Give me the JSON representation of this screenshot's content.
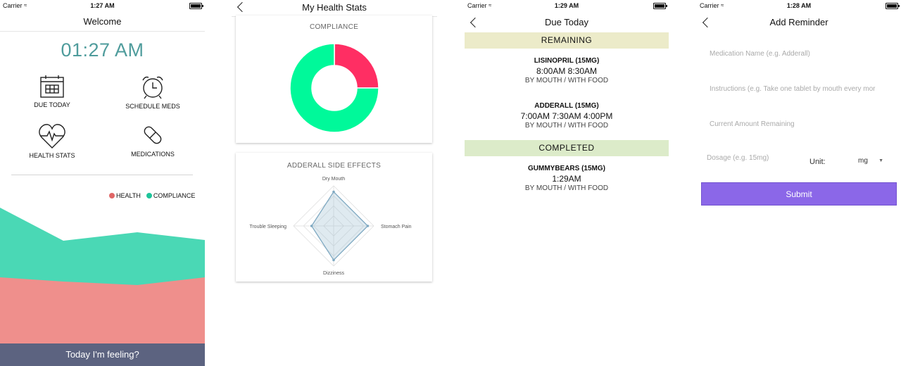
{
  "status": {
    "carrier": "Carrier"
  },
  "welcome": {
    "time": "1:27 AM",
    "title": "Welcome",
    "clock": "01:27 AM",
    "menu": [
      {
        "label": "DUE TODAY",
        "icon": "calendar-icon"
      },
      {
        "label": "SCHEDULE MEDS",
        "icon": "alarm-clock-icon"
      },
      {
        "label": "HEALTH STATS",
        "icon": "heart-pulse-icon"
      },
      {
        "label": "MEDICATIONS",
        "icon": "pill-icon"
      }
    ],
    "legend": [
      {
        "label": "HEALTH",
        "color": "#e06666"
      },
      {
        "label": "COMPLIANCE",
        "color": "#1ec49a"
      }
    ],
    "footer": "Today I'm feeling?"
  },
  "stats": {
    "title": "My Health Stats",
    "compliance_title": "COMPLIANCE",
    "side_effects_title": "ADDERALL SIDE EFFECTS",
    "chart_data": [
      {
        "type": "pie",
        "title": "COMPLIANCE",
        "values": [
          25,
          75
        ],
        "colors": [
          "#ff2e63",
          "#00f99a"
        ]
      },
      {
        "type": "radar",
        "title": "ADDERALL SIDE EFFECTS",
        "categories": [
          "Dry Mouth",
          "Stomach Pain",
          "Dizziness",
          "Trouble Sleeping"
        ],
        "values": [
          0.85,
          0.85,
          0.85,
          0.55
        ],
        "grid": true
      }
    ]
  },
  "due": {
    "time": "1:29 AM",
    "title": "Due Today",
    "remaining_label": "REMAINING",
    "completed_label": "COMPLETED",
    "remaining": [
      {
        "name": "LISINOPRIL (15MG)",
        "times": "8:00AM 8:30AM",
        "route": "BY MOUTH / WITH FOOD"
      },
      {
        "name": "ADDERALL (15MG)",
        "times": "7:00AM 7:30AM 4:00PM",
        "route": "BY MOUTH / WITH FOOD"
      }
    ],
    "completed": [
      {
        "name": "GUMMYBEARS (15MG)",
        "times": "1:29AM",
        "route": "BY MOUTH / WITH FOOD"
      }
    ]
  },
  "reminder": {
    "time": "1:28 AM",
    "title": "Add Reminder",
    "name_placeholder": "Medication Name (e.g. Adderall)",
    "instructions_placeholder": "Instructions (e.g. Take one tablet by mouth every mor",
    "amount_placeholder": "Current Amount Remaining",
    "dosage_placeholder": "Dosage (e.g. 15mg)",
    "unit_label": "Unit:",
    "unit_value": "mg",
    "submit": "Submit"
  }
}
